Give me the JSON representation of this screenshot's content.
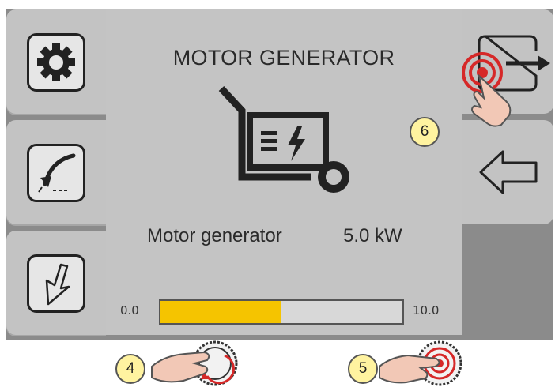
{
  "screen": {
    "title": "MOTOR GENERATOR",
    "parameter": {
      "label": "Motor generator",
      "value": "5.0 kW"
    },
    "scale": {
      "min": "0.0",
      "max": "10.0",
      "fill_fraction": 0.5
    }
  },
  "left_tabs": [
    {
      "name": "settings",
      "icon": "gear-icon"
    },
    {
      "name": "torch",
      "icon": "welding-torch-icon"
    },
    {
      "name": "down",
      "icon": "down-arrow-icon"
    }
  ],
  "right_tabs": [
    {
      "name": "exit",
      "icon": "exit-arrow-icon"
    },
    {
      "name": "back",
      "icon": "back-arrow-icon"
    }
  ],
  "callouts": {
    "knob_left": "4",
    "knob_right": "5",
    "exit_button": "6"
  },
  "colors": {
    "accent": "#f5c400",
    "panel": "#c4c4c4",
    "frame": "#8b8b8b",
    "callout": "#fff3a0",
    "touch_red": "#d62828"
  }
}
